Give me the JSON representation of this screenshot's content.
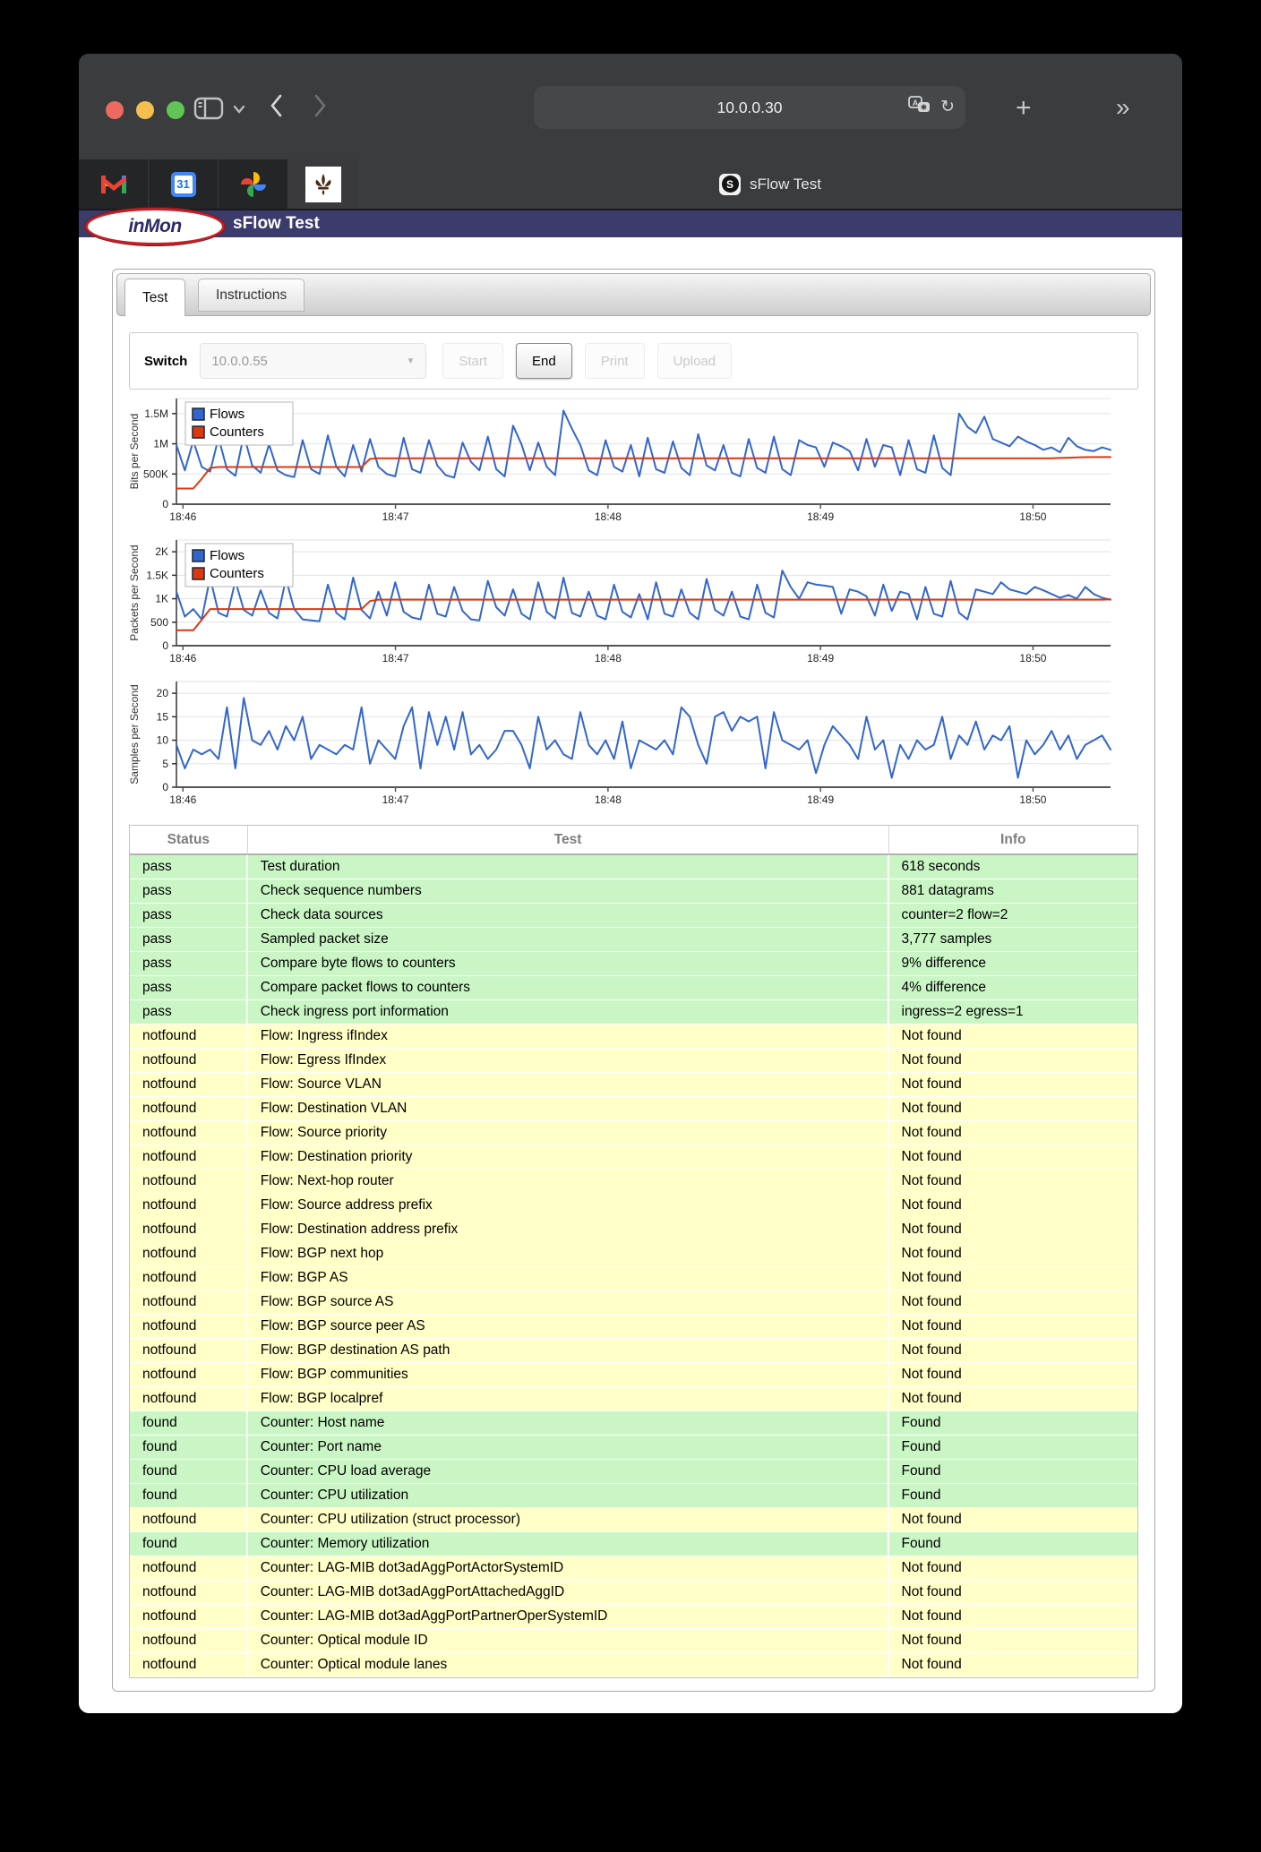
{
  "browser": {
    "url": "10.0.0.30",
    "active_tab_title": "sFlow Test",
    "favicon_letter": "S",
    "pinned_tabs": [
      {
        "name": "gmail"
      },
      {
        "name": "google-calendar",
        "label": "31"
      },
      {
        "name": "google-photos"
      },
      {
        "name": "scouting"
      }
    ]
  },
  "page": {
    "brand": "inMon",
    "title": "sFlow Test",
    "tabs": [
      {
        "label": "Test",
        "active": true
      },
      {
        "label": "Instructions",
        "active": false
      }
    ],
    "controls": {
      "switch_label": "Switch",
      "switch_value": "10.0.0.55",
      "buttons": [
        {
          "label": "Start",
          "enabled": false
        },
        {
          "label": "End",
          "enabled": true
        },
        {
          "label": "Print",
          "enabled": false
        },
        {
          "label": "Upload",
          "enabled": false
        }
      ]
    },
    "table": {
      "headers": [
        "Status",
        "Test",
        "Info"
      ],
      "rows": [
        [
          "pass",
          "Test duration",
          "618 seconds"
        ],
        [
          "pass",
          "Check sequence numbers",
          "881 datagrams"
        ],
        [
          "pass",
          "Check data sources",
          "counter=2 flow=2"
        ],
        [
          "pass",
          "Sampled packet size",
          "3,777 samples"
        ],
        [
          "pass",
          "Compare byte flows to counters",
          "9% difference"
        ],
        [
          "pass",
          "Compare packet flows to counters",
          "4% difference"
        ],
        [
          "pass",
          "Check ingress port information",
          "ingress=2 egress=1"
        ],
        [
          "notfound",
          "Flow: Ingress ifIndex",
          "Not found"
        ],
        [
          "notfound",
          "Flow: Egress IfIndex",
          "Not found"
        ],
        [
          "notfound",
          "Flow: Source VLAN",
          "Not found"
        ],
        [
          "notfound",
          "Flow: Destination VLAN",
          "Not found"
        ],
        [
          "notfound",
          "Flow: Source priority",
          "Not found"
        ],
        [
          "notfound",
          "Flow: Destination priority",
          "Not found"
        ],
        [
          "notfound",
          "Flow: Next-hop router",
          "Not found"
        ],
        [
          "notfound",
          "Flow: Source address prefix",
          "Not found"
        ],
        [
          "notfound",
          "Flow: Destination address prefix",
          "Not found"
        ],
        [
          "notfound",
          "Flow: BGP next hop",
          "Not found"
        ],
        [
          "notfound",
          "Flow: BGP AS",
          "Not found"
        ],
        [
          "notfound",
          "Flow: BGP source AS",
          "Not found"
        ],
        [
          "notfound",
          "Flow: BGP source peer AS",
          "Not found"
        ],
        [
          "notfound",
          "Flow: BGP destination AS path",
          "Not found"
        ],
        [
          "notfound",
          "Flow: BGP communities",
          "Not found"
        ],
        [
          "notfound",
          "Flow: BGP localpref",
          "Not found"
        ],
        [
          "found",
          "Counter: Host name",
          "Found"
        ],
        [
          "found",
          "Counter: Port name",
          "Found"
        ],
        [
          "found",
          "Counter: CPU load average",
          "Found"
        ],
        [
          "found",
          "Counter: CPU utilization",
          "Found"
        ],
        [
          "notfound",
          "Counter: CPU utilization (struct processor)",
          "Not found"
        ],
        [
          "found",
          "Counter: Memory utilization",
          "Found"
        ],
        [
          "notfound",
          "Counter: LAG-MIB dot3adAggPortActorSystemID",
          "Not found"
        ],
        [
          "notfound",
          "Counter: LAG-MIB dot3adAggPortAttachedAggID",
          "Not found"
        ],
        [
          "notfound",
          "Counter: LAG-MIB dot3adAggPortPartnerOperSystemID",
          "Not found"
        ],
        [
          "notfound",
          "Counter: Optical module ID",
          "Not found"
        ],
        [
          "notfound",
          "Counter: Optical module lanes",
          "Not found"
        ]
      ]
    }
  },
  "colors": {
    "flows_blue": "#3366cc",
    "counters_red": "#dc3912",
    "pass_green": "#c9f6c4",
    "notfound_yellow": "#ffffc8",
    "brand_navy": "#3b3b6c"
  },
  "chart_data": [
    {
      "type": "line",
      "name": "bits-per-second",
      "ylabel": "Bits per Second",
      "ymax": 1750,
      "ylim": [
        0,
        1750
      ],
      "grid": true,
      "legend": true,
      "legend_position": "top-left",
      "yticks": [
        {
          "v": 0,
          "label": "0"
        },
        {
          "v": 500,
          "label": "500K"
        },
        {
          "v": 1000,
          "label": "1M"
        },
        {
          "v": 1500,
          "label": "1.5M"
        }
      ],
      "xticks": [
        {
          "f": 0.007,
          "label": "18:46"
        },
        {
          "f": 0.2345,
          "label": "18:47"
        },
        {
          "f": 0.462,
          "label": "18:48"
        },
        {
          "f": 0.6895,
          "label": "18:49"
        },
        {
          "f": 0.917,
          "label": "18:50"
        }
      ],
      "y_unit": "Kbits/s",
      "series": [
        {
          "name": "Flows",
          "color": "#3366cc",
          "values": [
            980,
            560,
            1050,
            620,
            540,
            1100,
            580,
            470,
            1150,
            640,
            520,
            990,
            560,
            480,
            450,
            1060,
            580,
            500,
            1140,
            620,
            460,
            980,
            540,
            1080,
            620,
            500,
            460,
            1100,
            580,
            520,
            1060,
            640,
            480,
            440,
            1020,
            700,
            560,
            1120,
            580,
            460,
            1300,
            990,
            560,
            1020,
            620,
            480,
            1550,
            1250,
            980,
            560,
            480,
            1060,
            620,
            540,
            980,
            460,
            1100,
            580,
            520,
            1040,
            600,
            480,
            1160,
            640,
            560,
            980,
            520,
            460,
            1080,
            600,
            520,
            1120,
            580,
            480,
            1060,
            980,
            940,
            620,
            1020,
            960,
            880,
            560,
            1080,
            620,
            980,
            940,
            480,
            1060,
            580,
            520,
            1140,
            600,
            480,
            1500,
            1280,
            1180,
            1450,
            1080,
            1020,
            960,
            1120,
            1040,
            980,
            900,
            940,
            860,
            1100,
            960,
            900,
            880,
            940,
            900
          ]
        },
        {
          "name": "Counters",
          "color": "#dc3912",
          "values": [
            260,
            260,
            260,
            420,
            600,
            615,
            615,
            615,
            615,
            615,
            615,
            615,
            615,
            615,
            615,
            615,
            615,
            615,
            615,
            615,
            615,
            615,
            615,
            750,
            760,
            760,
            760,
            760,
            760,
            760,
            760,
            760,
            760,
            760,
            760,
            760,
            760,
            760,
            760,
            760,
            760,
            760,
            760,
            760,
            760,
            760,
            760,
            760,
            760,
            760,
            760,
            760,
            760,
            760,
            760,
            760,
            760,
            760,
            760,
            760,
            760,
            760,
            760,
            760,
            760,
            760,
            760,
            760,
            760,
            760,
            760,
            760,
            760,
            760,
            760,
            760,
            760,
            760,
            760,
            760,
            760,
            760,
            760,
            760,
            760,
            760,
            760,
            760,
            760,
            760,
            760,
            760,
            760,
            760,
            760,
            760,
            760,
            760,
            760,
            760,
            760,
            760,
            760,
            760,
            760,
            765,
            770,
            775,
            778,
            780,
            780,
            780
          ]
        }
      ]
    },
    {
      "type": "line",
      "name": "packets-per-second",
      "ylabel": "Packets per Second",
      "ymax": 2250,
      "ylim": [
        0,
        2250
      ],
      "grid": true,
      "legend": true,
      "legend_position": "top-left",
      "yticks": [
        {
          "v": 0,
          "label": "0"
        },
        {
          "v": 500,
          "label": "500"
        },
        {
          "v": 1000,
          "label": "1K"
        },
        {
          "v": 1500,
          "label": "1.5K"
        },
        {
          "v": 2000,
          "label": "2K"
        }
      ],
      "xticks": [
        {
          "f": 0.007,
          "label": "18:46"
        },
        {
          "f": 0.2345,
          "label": "18:47"
        },
        {
          "f": 0.462,
          "label": "18:48"
        },
        {
          "f": 0.6895,
          "label": "18:49"
        },
        {
          "f": 0.917,
          "label": "18:50"
        }
      ],
      "y_unit": "packets/s",
      "series": [
        {
          "name": "Flows",
          "color": "#3366cc",
          "values": [
            1150,
            620,
            780,
            560,
            1450,
            700,
            620,
            1380,
            760,
            640,
            1180,
            700,
            580,
            1420,
            780,
            560,
            540,
            520,
            1300,
            700,
            560,
            1450,
            760,
            580,
            1150,
            640,
            1350,
            720,
            600,
            560,
            1300,
            680,
            620,
            1250,
            740,
            560,
            540,
            1380,
            820,
            640,
            1200,
            680,
            560,
            1350,
            720,
            580,
            1450,
            700,
            620,
            1150,
            640,
            560,
            1300,
            720,
            600,
            1100,
            560,
            1350,
            680,
            620,
            1200,
            700,
            560,
            1420,
            760,
            640,
            1150,
            620,
            560,
            1300,
            700,
            600,
            1600,
            1250,
            1000,
            1350,
            1300,
            1280,
            1250,
            680,
            1200,
            1150,
            1050,
            640,
            1300,
            740,
            1150,
            1100,
            560,
            1250,
            680,
            620,
            1380,
            700,
            560,
            1200,
            1150,
            1100,
            1350,
            1200,
            1150,
            1100,
            1250,
            1180,
            1100,
            1020,
            1080,
            1000,
            1250,
            1100,
            1020,
            980
          ]
        },
        {
          "name": "Counters",
          "color": "#dc3912",
          "values": [
            330,
            330,
            330,
            550,
            780,
            780,
            780,
            780,
            780,
            780,
            780,
            780,
            780,
            780,
            780,
            780,
            780,
            780,
            780,
            780,
            780,
            780,
            780,
            950,
            980,
            980,
            980,
            980,
            980,
            980,
            980,
            980,
            980,
            980,
            980,
            980,
            980,
            980,
            980,
            980,
            980,
            980,
            980,
            980,
            980,
            980,
            980,
            980,
            980,
            980,
            980,
            980,
            980,
            980,
            980,
            980,
            980,
            980,
            980,
            980,
            980,
            980,
            980,
            980,
            980,
            980,
            980,
            980,
            980,
            980,
            980,
            980,
            980,
            980,
            980,
            980,
            980,
            980,
            980,
            980,
            980,
            980,
            980,
            980,
            980,
            980,
            980,
            980,
            980,
            980,
            980,
            980,
            980,
            980,
            980,
            980,
            980,
            980,
            980,
            980,
            980,
            980,
            980,
            980,
            980,
            980,
            980,
            980,
            980,
            980,
            980,
            985
          ]
        }
      ]
    },
    {
      "type": "line",
      "name": "samples-per-second",
      "ylabel": "Samples per Second",
      "ymax": 22.5,
      "ylim": [
        0,
        22.5
      ],
      "grid": true,
      "legend": false,
      "yticks": [
        {
          "v": 0,
          "label": "0"
        },
        {
          "v": 5,
          "label": "5"
        },
        {
          "v": 10,
          "label": "10"
        },
        {
          "v": 15,
          "label": "15"
        },
        {
          "v": 20,
          "label": "20"
        }
      ],
      "xticks": [
        {
          "f": 0.007,
          "label": "18:46"
        },
        {
          "f": 0.2345,
          "label": "18:47"
        },
        {
          "f": 0.462,
          "label": "18:48"
        },
        {
          "f": 0.6895,
          "label": "18:49"
        },
        {
          "f": 0.917,
          "label": "18:50"
        }
      ],
      "y_unit": "samples/s",
      "series": [
        {
          "name": "Samples",
          "color": "#3366cc",
          "values": [
            9,
            4,
            8,
            7,
            8,
            6,
            17,
            4,
            19,
            10,
            9,
            12,
            8,
            13,
            10,
            15,
            6,
            9,
            8,
            7,
            9,
            8,
            17,
            5,
            10,
            8,
            6,
            13,
            17,
            4,
            16,
            9,
            15,
            8,
            16,
            7,
            9,
            6,
            8,
            12,
            12,
            9,
            4,
            15,
            8,
            10,
            7,
            6,
            16,
            9,
            7,
            10,
            6,
            14,
            4,
            10,
            9,
            8,
            10,
            7,
            17,
            15,
            9,
            5,
            15,
            16,
            12,
            15,
            14,
            15,
            4,
            16,
            10,
            9,
            8,
            10,
            3,
            9,
            13,
            11,
            9,
            6,
            15,
            8,
            10,
            2,
            9,
            6,
            10,
            8,
            9,
            15,
            6,
            11,
            9,
            14,
            8,
            11,
            10,
            13,
            2,
            10,
            7,
            9,
            12,
            8,
            11,
            6,
            9,
            10,
            11,
            8
          ]
        }
      ]
    }
  ]
}
